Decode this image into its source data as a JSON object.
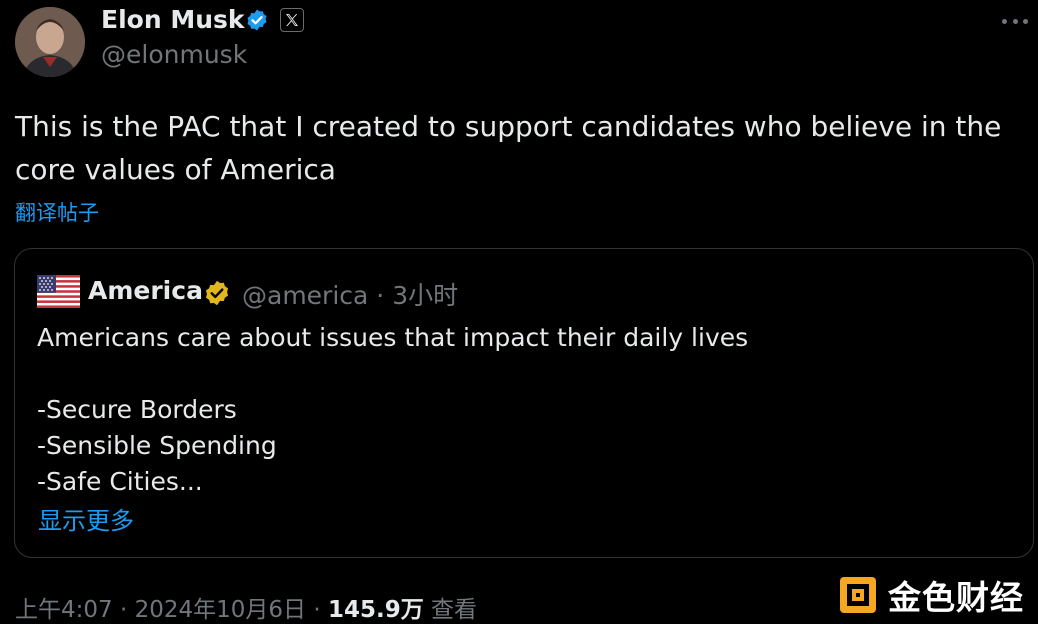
{
  "author": {
    "name": "Elon Musk",
    "handle": "@elonmusk",
    "verified_icon": "verified-badge-icon",
    "affiliation_icon": "x-logo-icon"
  },
  "tweet": {
    "text": "This is the PAC that I created to support candidates who believe in the core values of America",
    "translate_label": "翻译帖子"
  },
  "quote": {
    "name": "America",
    "handle": "@america",
    "separator": "·",
    "time": "3小时",
    "lines": [
      "Americans care about issues that impact their daily lives",
      "",
      "-Secure Borders",
      "-Sensible Spending",
      "-Safe Cities..."
    ],
    "show_more_label": "显示更多"
  },
  "footer": {
    "time": "上午4:07",
    "date": "2024年10月6日",
    "separator": "·",
    "views_count": "145.9万",
    "views_label": "查看"
  },
  "watermark": {
    "text": "金色财经"
  },
  "colors": {
    "background": "#000000",
    "text_primary": "#e7e9ea",
    "text_secondary": "#71767b",
    "link": "#1d9bf0",
    "verified_blue": "#1d9bf0",
    "verified_gold": "#e2b719",
    "border": "#2f3336"
  }
}
